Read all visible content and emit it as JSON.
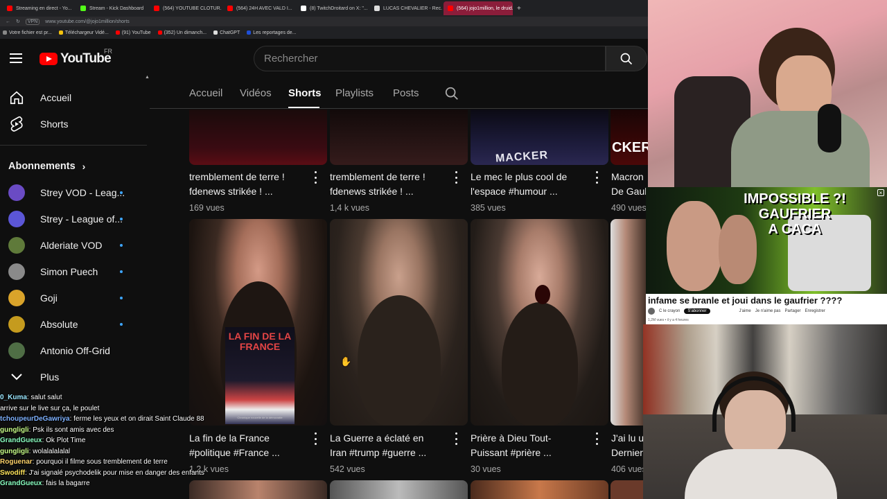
{
  "browser": {
    "tabs": [
      {
        "label": "Streaming en direct - Yo...",
        "color": "#ff0000",
        "active": false
      },
      {
        "label": "Stream - Kick Dashboard",
        "color": "#53fc18",
        "active": false
      },
      {
        "label": "(564) YOUTUBE CLOTUR...",
        "color": "#ff0000",
        "active": false
      },
      {
        "label": "(564) 24H AVEC VALD I...",
        "color": "#ff0000",
        "active": false
      },
      {
        "label": "(8) TwitchDroitard on X: \"...",
        "color": "#ffffff",
        "active": false
      },
      {
        "label": "LUCAS CHEVALIER - Rec...",
        "color": "#dddddd",
        "active": false
      },
      {
        "label": "(564) jojo1million, le druid...",
        "color": "#ff0000",
        "active": true
      }
    ],
    "new_tab": "+",
    "url": "www.youtube.com/@jojo1million/shorts",
    "vpn": "VPN",
    "bookmarks": [
      {
        "label": "Votre fichier est pr...",
        "color": "#888888"
      },
      {
        "label": "Téléchargeur Vidé...",
        "color": "#f4c20d"
      },
      {
        "label": "(91) YouTube",
        "color": "#ff0000"
      },
      {
        "label": "(352) Un dimanch...",
        "color": "#ff0000"
      },
      {
        "label": "ChatGPT",
        "color": "#dddddd"
      },
      {
        "label": "Les reportages de...",
        "color": "#1e4fd8"
      }
    ]
  },
  "youtube": {
    "logo_text": "YouTube",
    "country": "FR",
    "search_placeholder": "Rechercher"
  },
  "sidebar": {
    "main": [
      {
        "label": "Accueil",
        "icon": "home-icon"
      },
      {
        "label": "Shorts",
        "icon": "shorts-icon"
      }
    ],
    "subscriptions_title": "Abonnements",
    "subscriptions": [
      {
        "label": "Strey VOD - Leag...",
        "color": "#6a4bc4",
        "live": true
      },
      {
        "label": "Strey - League of...",
        "color": "#5b56d6",
        "live": true
      },
      {
        "label": "Alderiate VOD",
        "color": "#5f7a3a",
        "live": true
      },
      {
        "label": "Simon Puech",
        "color": "#8a8a8a",
        "live": true
      },
      {
        "label": "Goji",
        "color": "#d9a32a",
        "live": true
      },
      {
        "label": "Absolute",
        "color": "#c59b1e",
        "live": true
      },
      {
        "label": "Antonio Off-Grid",
        "color": "#4f6e45",
        "live": false
      }
    ],
    "more_label": "Plus"
  },
  "channel_tabs": [
    {
      "label": "Accueil",
      "active": false
    },
    {
      "label": "Vidéos",
      "active": false
    },
    {
      "label": "Shorts",
      "active": true
    },
    {
      "label": "Playlists",
      "active": false
    },
    {
      "label": "Posts",
      "active": false
    }
  ],
  "shorts_row1": [
    {
      "title_line1": "tremblement de terre !",
      "title_line2": "fdenews strikée ! ...",
      "views": "169 vues"
    },
    {
      "title_line1": "tremblement de terre !",
      "title_line2": "fdenews strikée ! ...",
      "views": "1,4 k vues"
    },
    {
      "title_line1": "Le mec le plus cool de",
      "title_line2": "l'espace #humour ...",
      "views": "385 vues",
      "thumb_text": "MACKER"
    },
    {
      "title_line1": "Macron",
      "title_line2": "De Gaul",
      "views": "490 vues",
      "thumb_text": "CKER"
    }
  ],
  "shorts_row2": [
    {
      "title_line1": "La fin de la France",
      "title_line2": "#politique #France ...",
      "views": "1,2 k vues",
      "poster_title": "LA FIN DE LA FRANCE",
      "poster_sub": "Chronique nouvelle de la démocratie"
    },
    {
      "title_line1": "La Guerre a éclaté en",
      "title_line2": "Iran #trump #guerre ...",
      "views": "542 vues"
    },
    {
      "title_line1": "Prière à Dieu Tout-",
      "title_line2": "Puissant #prière ...",
      "views": "30 vues"
    },
    {
      "title_line1": "J'ai lu u",
      "title_line2": "Dernier",
      "views": "406 vues"
    }
  ],
  "chat": [
    {
      "user": "0_Kuma",
      "text": "salut salut",
      "color": "#9be7ff"
    },
    {
      "user": "",
      "text": "arrive sur le live sur ça, le poulet",
      "color": "#ff6b6b"
    },
    {
      "user": "tchoupeurDeGawriya",
      "text": "ferme les yeux et on dirait Saint Claude 88",
      "color": "#7fb2ff"
    },
    {
      "user": "gungligli",
      "text": "Psk ils sont amis avec des",
      "color": "#c9ff8a"
    },
    {
      "user": "GrandGueux",
      "text": "Ok Plot Time",
      "color": "#8affc1"
    },
    {
      "user": "gungligli",
      "text": "wolalalalalal",
      "color": "#c9ff8a"
    },
    {
      "user": "Roguenar",
      "text": "pourquoi il filme sous tremblement de terre",
      "color": "#ffd36b"
    },
    {
      "user": "Swodiff",
      "text": "J'ai signalé psychodelik pour mise en danger des enfants",
      "color": "#ffe45c"
    },
    {
      "user": "GrandGueux",
      "text": "fais la bagarre",
      "color": "#8affc1"
    }
  ],
  "overlay_video": {
    "headline1": "IMPOSSIBLE ?!",
    "headline2": "GAUFRIER",
    "headline3": "A CACA",
    "title": "infame se branle et joui dans le gaufrier ????",
    "channel": "C le crayon",
    "subscribe": "S'abonner",
    "actions": [
      "J'aime",
      "Je n'aime pas",
      "Partager",
      "Enregistrer"
    ],
    "meta": "1,2M vues • il y a 4 heures"
  },
  "colors": {
    "accent_red": "#ff0000",
    "live_blue": "#3ea6ff",
    "bg": "#0f0f0f"
  }
}
